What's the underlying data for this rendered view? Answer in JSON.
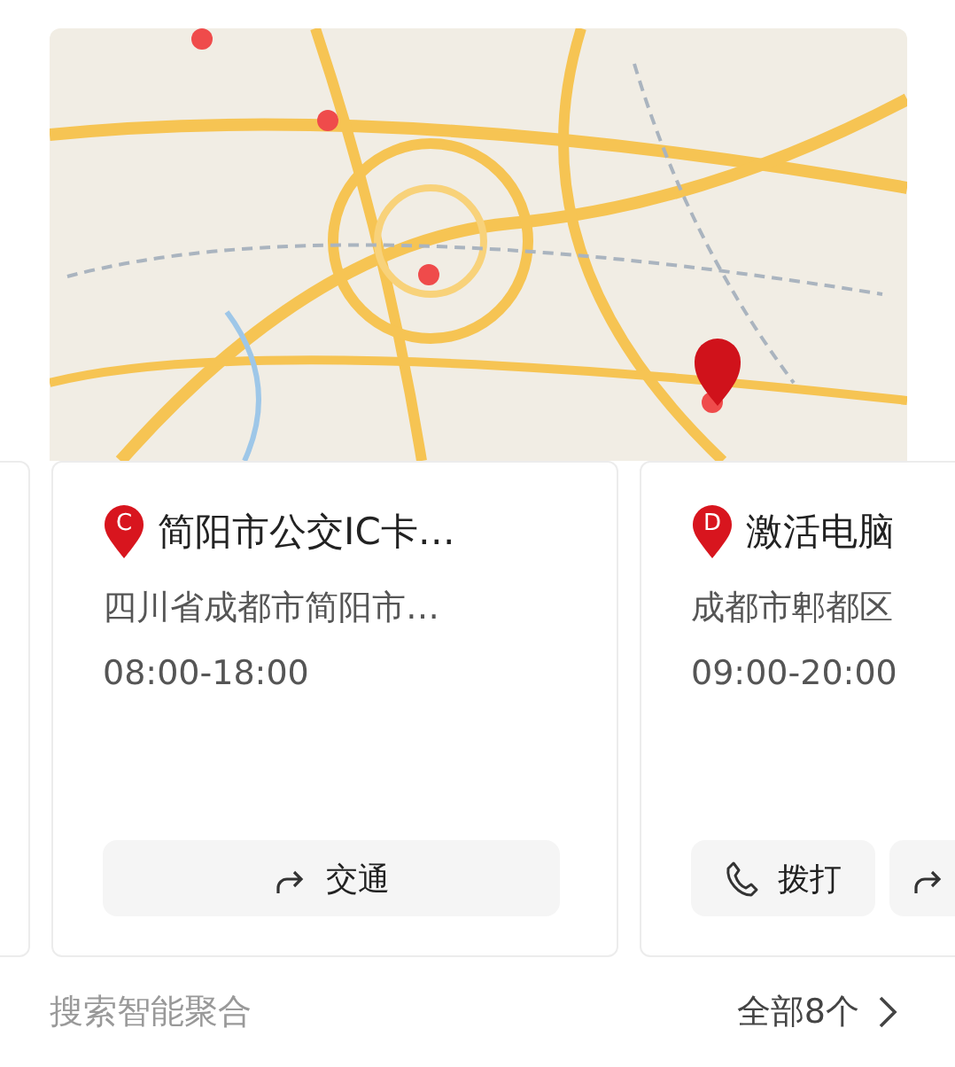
{
  "cards": [
    {
      "pin": "C",
      "title": "简阳市公交IC卡…",
      "address": "四川省成都市简阳市…",
      "hours": "08:00-18:00",
      "actions": [
        {
          "kind": "route",
          "label": "交通"
        }
      ]
    },
    {
      "pin": "D",
      "title": "激活电脑",
      "address": "成都市郫都区",
      "hours": "09:00-20:00",
      "actions": [
        {
          "kind": "call",
          "label": "拨打"
        },
        {
          "kind": "route"
        }
      ]
    }
  ],
  "footer": {
    "source": "搜索智能聚合",
    "more": "全部8个"
  }
}
